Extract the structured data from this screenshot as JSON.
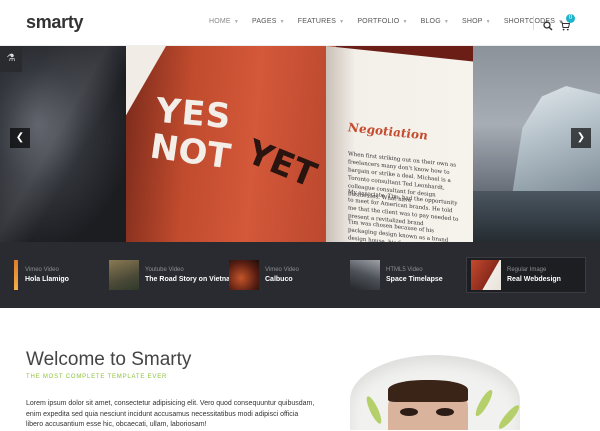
{
  "header": {
    "logo": "smarty",
    "nav": [
      {
        "label": "HOME",
        "active": true
      },
      {
        "label": "PAGES"
      },
      {
        "label": "FEATURES"
      },
      {
        "label": "PORTFOLIO"
      },
      {
        "label": "BLOG"
      },
      {
        "label": "SHOP"
      },
      {
        "label": "SHORTCODES"
      }
    ],
    "cart_count": "0"
  },
  "slider": {
    "book": {
      "word1": "YES",
      "word2": "NOT",
      "word3": "YET",
      "heading": "Negotiation",
      "para1": "When first striking out on their own as freelancers many don't know how to bargain or strike a deal. Michael is a Toronto consultant Ted Leonhardt, colleague consultant for design businesses. What have",
      "para2": "My associate, Tim, had the opportunity to meet for American brands. He told me that the client was to pay needed to present a revitalized brand",
      "para3": "Tim was chosen because of his packaging design known as a brand design house, his firm was hired and came with packaging that overlapped, desperate for this package"
    }
  },
  "thumbnails": [
    {
      "type": "Vimeo Video",
      "title": "Hola Llamigo"
    },
    {
      "type": "Youtube Video",
      "title": "The Road Story on Vietnam"
    },
    {
      "type": "Vimeo Video",
      "title": "Calbuco"
    },
    {
      "type": "HTML5 Video",
      "title": "Space Timelapse"
    },
    {
      "type": "Regular Image",
      "title": "Real Webdesign"
    }
  ],
  "welcome": {
    "title": "Welcome to Smarty",
    "subtitle": "THE MOST COMPLETE TEMPLATE EVER",
    "body": "Lorem ipsum dolor sit amet, consectetur adipisicing elit. Vero quod consequuntur quibusdam, enim expedita sed quia nesciunt incidunt accusamus necessitatibus modi adipisci officia libero accusantium esse hic, obcaecati, ullam, laboriosam!"
  },
  "colors": {
    "accent_green": "#8fc23a",
    "cart_badge": "#1fb3c9",
    "thumb_strip": "#292b30"
  },
  "icons": [
    "search-icon",
    "cart-icon",
    "flask-icon",
    "chevron-left-icon",
    "chevron-right-icon"
  ]
}
